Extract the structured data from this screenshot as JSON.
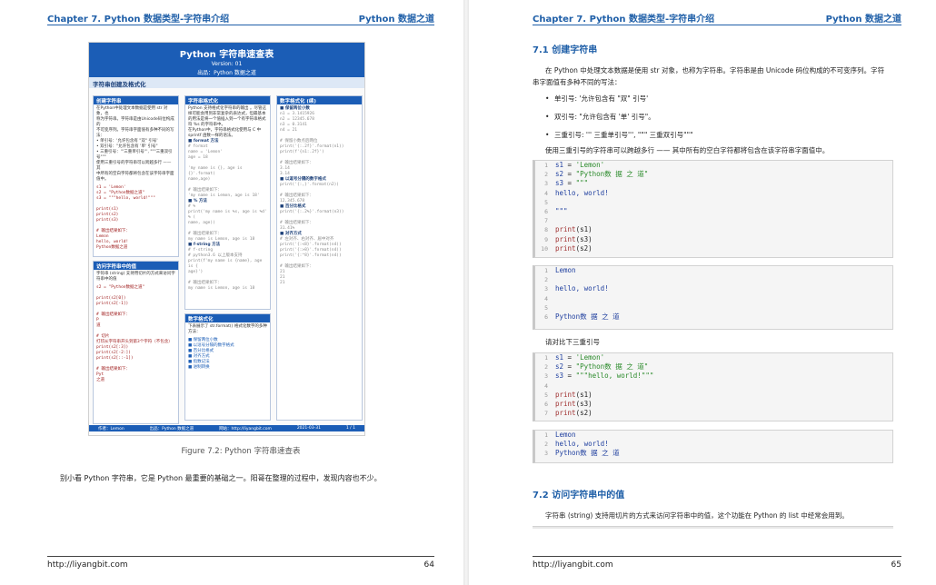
{
  "left": {
    "header_left": "Chapter 7.  Python 数据类型-字符串介绍",
    "header_right": "Python 数据之道",
    "sheet": {
      "title": "Python 字符串速查表",
      "version": "Version: 01",
      "source": "出品：Python 数据之道",
      "subtitle": "字符串创建及格式化",
      "boxes": {
        "create": {
          "head": "创建字符串",
          "lines": [
            "在Python中处理文本数据是使用 str 对象，也",
            "称为字符串。字符串是由Unicode码位构成的",
            "不可变序列。字符串字面值有多种不同的写",
            "法：",
            "• 单引号：'允许包含有 \"双\" 引号'",
            "• 双引号：\"允许包含有 '单' 引号\"",
            "• 三重引号：'''三重单引号''', \"\"\"三重双引",
            "号\"\"\"",
            "使用三重引号的字符串可以跨越多行 —— 其",
            "中所有的空白字符都将包含在该字符串字面",
            "值中。"
          ],
          "code": [
            "s1 = 'Lemon'",
            "s2 = \"Python数据之道\"",
            "s3 = \"\"\"hello, world!\"\"\"",
            "",
            "print(s1)",
            "print(s2)",
            "print(s3)",
            "",
            "# 输出结果如下：",
            "Lemon",
            "hello, world!",
            "Python数据之道"
          ]
        },
        "access": {
          "head": "访问字符串中的值",
          "lines": [
            "字符串 (string) 支持用切片的方式来访问字",
            "符串中的值"
          ],
          "code": [
            "s2 = \"Python数据之道\"",
            "",
            "print(s2[0])",
            "print(s2[-1])",
            "",
            "# 输出结果如下：",
            "P",
            "道",
            "",
            "# 切片",
            "打印从字符串开头到第3个字符（不包含）",
            "print(s2[:3])",
            "print(s2[-2:])",
            "print(s2[::-1])",
            "",
            "# 输出结果如下：",
            "Pyt",
            "之道"
          ]
        },
        "format": {
          "head": "字符串格式化",
          "lines": [
            "Python 支持格式化字符串的输出 。尽管这",
            "样可能会用到非常复杂的表达式，但最基本",
            "的用法是将一个值插入到一个有字符串格式",
            "符 %s 的字符串中。",
            "在Python中，字符串格式化使用与 C 中",
            "sprintf 函数一样的语法。"
          ],
          "sec1": "■ format 方法",
          "code1": [
            "# format",
            "name = 'Lemon'",
            "age = 18",
            "",
            "'my name is {}, age is {}'.format(",
            "    name,age)",
            "",
            "# 输出结果如下：",
            "'my name is Lemon, age is 18'"
          ],
          "sec2": "■ % 方法",
          "code2": [
            "# %",
            "print('my name is %s, age is %d' % (",
            "    name, age))",
            "",
            "# 输出结果如下：",
            "my name is Lemon, age is 18"
          ],
          "sec3": "■ f-string 方法",
          "code3": [
            "# f-string",
            "# python3.6 以上版本支持",
            "print(f'my name is {name}, age is {",
            "    age}')",
            "",
            "# 输出结果如下：",
            "my name is Lemon, age is 18"
          ]
        },
        "number": {
          "head": "数字格式化",
          "lines": [
            "下表展示了 str.format() 格式化数字的多种",
            "方法："
          ],
          "items": [
            "■ 保留两位小数",
            "■ 以逗号分隔的数字格式",
            "■ 百分比格式",
            "■ 对齐方式",
            "■ 指数记法",
            "■ 进制转换"
          ]
        },
        "number_code": {
          "head": "数字格式化 (续)",
          "sec1": "■ 保留两位小数",
          "code1": [
            "n1 = 3.1415926",
            "n2 = 12345.678",
            "n3 = 0.3141",
            "n4 = 21",
            "",
            "# 保留小数点后两位",
            "print('{:.2f}'.format(n1))",
            "print(f'{n1:.2f}')",
            "",
            "# 输出结果如下：",
            "3.14",
            "3.14"
          ],
          "sec2": "■ 以逗号分隔的数字格式",
          "code2": [
            "print('{:,}'.format(n2))",
            "",
            "# 输出结果如下：",
            "12,345.678"
          ],
          "sec3": "■ 百分比格式",
          "code3": [
            "print('{:.2%}'.format(n3))",
            "",
            "# 输出结果如下：",
            "31.41%"
          ],
          "sec4": "■ 对齐方式",
          "code4": [
            "# 左对齐、右对齐、居中对齐",
            "print('{:<8}'.format(n4))",
            "print('{:>8}'.format(n4))",
            "print('{:^8}'.format(n4))",
            "",
            "# 输出结果如下：",
            "21",
            "      21",
            "   21"
          ]
        }
      },
      "bar_author": "作者：Lemon",
      "bar_source": "出品：Python 数据之道",
      "bar_site": "网站：http://liyangbit.com",
      "bar_date": "2021-03-31",
      "bar_page": "1 / 1"
    },
    "caption": "Figure 7.2: Python 字符串速查表",
    "paragraph": "别小看 Python 字符串，它是 Python 最重要的基础之一。阳哥在整理的过程中，发现内容也不少。",
    "footer_url": "http://liyangbit.com",
    "footer_page": "64"
  },
  "right": {
    "header_left": "Chapter 7.  Python 数据类型-字符串介绍",
    "header_right": "Python 数据之道",
    "section_1": "7.1  创建字符串",
    "intro_1": "在 Python 中处理文本数据是使用 str 对象，也称为字符串。字符串是由 Unicode 码位构成的不可变序列。字符",
    "intro_2": "串字面值有多种不同的写法：",
    "bullets": [
      "单引号: '允许包含有 \"双\" 引号'",
      "双引号: \"允许包含有 '单' 引号\"。",
      "三重引号: ''' 三重单引号''', \"\"\" 三重双引号\"\"\""
    ],
    "triple_note": "使用三重引号的字符串可以跨越多行 —— 其中所有的空白字符都将包含在该字符串字面值中。",
    "code1": [
      {
        "n": "1",
        "var": "s1",
        "val": "'Lemon'"
      },
      {
        "n": "2",
        "var": "s2",
        "val": "\"Python数 据 之 道\""
      },
      {
        "n": "3",
        "var": "s3",
        "val": "\"\"\""
      },
      {
        "n": "4",
        "raw": "hello, world!"
      },
      {
        "n": "5",
        "raw": ""
      },
      {
        "n": "6",
        "raw": "\"\"\""
      },
      {
        "n": "7",
        "raw": ""
      },
      {
        "n": "8",
        "fn": "print",
        "arg": "s1"
      },
      {
        "n": "9",
        "fn": "print",
        "arg": "s3"
      },
      {
        "n": "10",
        "fn": "print",
        "arg": "s2"
      }
    ],
    "out1": [
      {
        "n": "1",
        "t": "Lemon"
      },
      {
        "n": "2",
        "t": ""
      },
      {
        "n": "3",
        "t": "hello, world!"
      },
      {
        "n": "4",
        "t": ""
      },
      {
        "n": "5",
        "t": ""
      },
      {
        "n": "6",
        "t": "Python数 据 之 道"
      }
    ],
    "note_2": "请对比下三重引号",
    "code2": [
      {
        "n": "1",
        "var": "s1",
        "val": "'Lemon'"
      },
      {
        "n": "2",
        "var": "s2",
        "val": "\"Python数 据 之 道\""
      },
      {
        "n": "3",
        "var": "s3",
        "val": "\"\"\"hello, world!\"\"\""
      },
      {
        "n": "4",
        "raw": ""
      },
      {
        "n": "5",
        "fn": "print",
        "arg": "s1"
      },
      {
        "n": "6",
        "fn": "print",
        "arg": "s3"
      },
      {
        "n": "7",
        "fn": "print",
        "arg": "s2"
      }
    ],
    "out2": [
      {
        "n": "1",
        "t": "Lemon"
      },
      {
        "n": "2",
        "t": "hello, world!"
      },
      {
        "n": "3",
        "t": "Python数 据 之 道"
      }
    ],
    "section_2": "7.2  访问字符串中的值",
    "para_2": "字符串 (string) 支持用切片的方式来访问字符串中的值，这个功能在 Python 的 list 中经常会用到。",
    "footer_url": "http://liyangbit.com",
    "footer_page": "65"
  }
}
